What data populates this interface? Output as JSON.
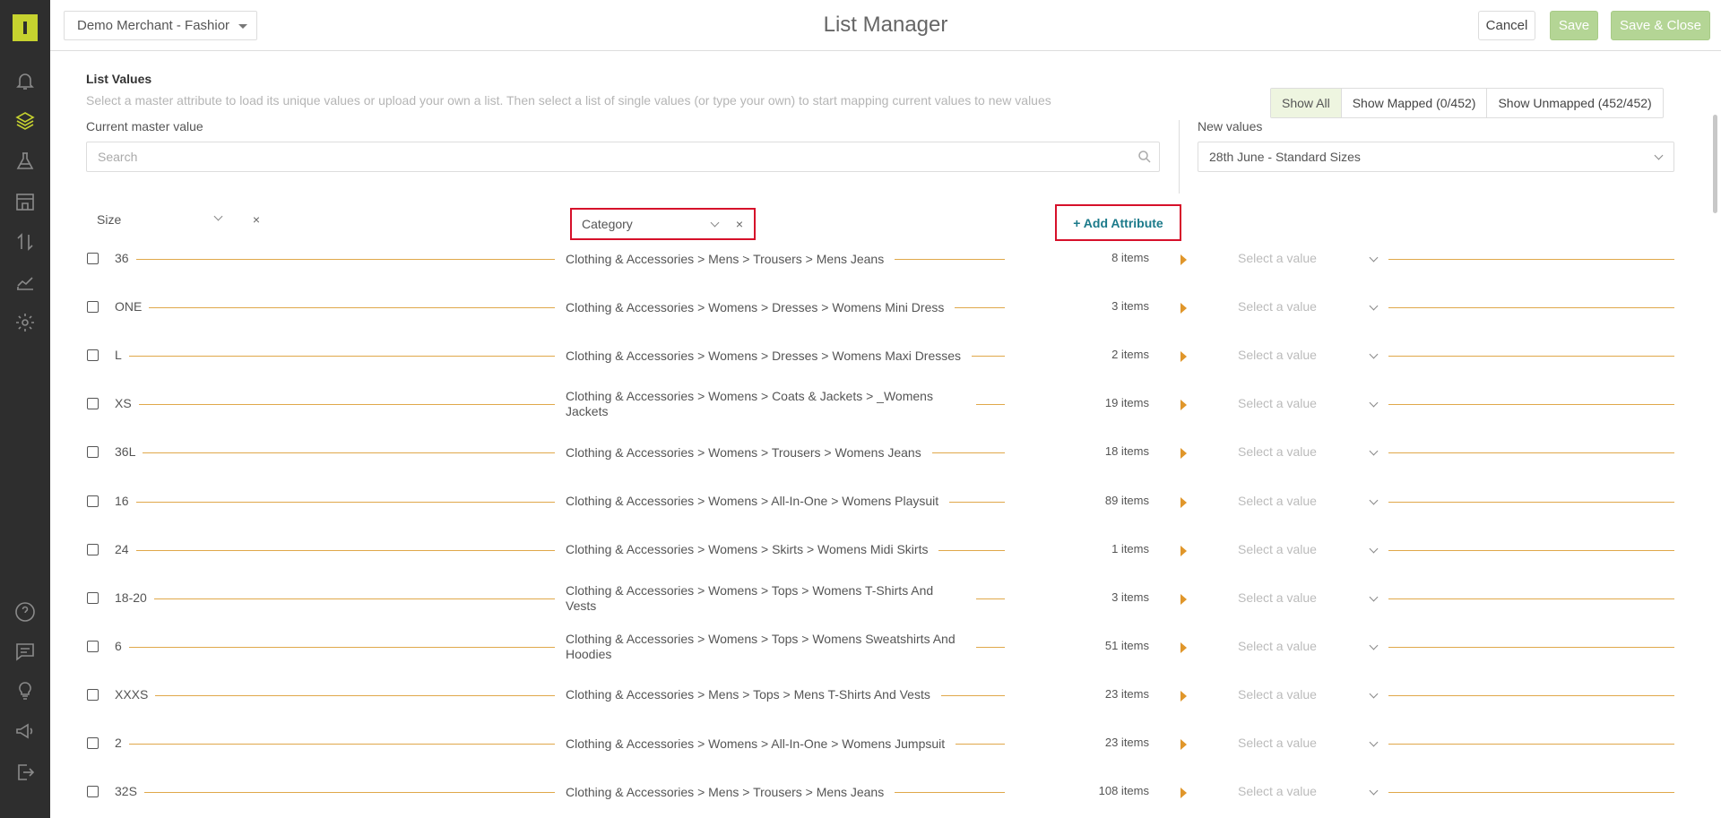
{
  "header": {
    "merchant": "Demo Merchant - Fashior",
    "title": "List Manager",
    "cancel_label": "Cancel",
    "save_label": "Save",
    "save_close_label": "Save & Close"
  },
  "sidebar": {
    "icons": [
      "bell-icon",
      "layers-icon",
      "flask-icon",
      "store-icon",
      "transfer-icon",
      "chart-icon",
      "gear-icon",
      "help-icon",
      "chat-icon",
      "lightbulb-icon",
      "megaphone-icon",
      "logout-icon"
    ],
    "active": "layers-icon"
  },
  "list_values": {
    "title": "List Values",
    "description": "Select a master attribute to load its unique values or upload your own a list. Then select a list of single values (or type your own) to start mapping current values to new values"
  },
  "filters": [
    {
      "label": "Show All",
      "active": true
    },
    {
      "label": "Show Mapped (0/452)",
      "active": false
    },
    {
      "label": "Show Unmapped (452/452)",
      "active": false
    }
  ],
  "current_master": {
    "label": "Current master value",
    "search_placeholder": "Search"
  },
  "new_values": {
    "label": "New values",
    "selected": "28th June - Standard Sizes"
  },
  "attributes": {
    "size": "Size",
    "category": "Category",
    "add_label": "+ Add Attribute"
  },
  "rows": [
    {
      "value": "36",
      "category": "Clothing & Accessories > Mens > Trousers > Mens Jeans",
      "count": "8 items",
      "placeholder": "Select a value"
    },
    {
      "value": "ONE",
      "category": "Clothing & Accessories > Womens > Dresses > Womens Mini Dress",
      "count": "3 items",
      "placeholder": "Select a value"
    },
    {
      "value": "L",
      "category": "Clothing & Accessories > Womens > Dresses > Womens Maxi Dresses",
      "count": "2 items",
      "placeholder": "Select a value"
    },
    {
      "value": "XS",
      "category": "Clothing & Accessories > Womens > Coats & Jackets > _Womens Jackets",
      "count": "19 items",
      "placeholder": "Select a value"
    },
    {
      "value": "36L",
      "category": "Clothing & Accessories > Womens > Trousers > Womens Jeans",
      "count": "18 items",
      "placeholder": "Select a value"
    },
    {
      "value": "16",
      "category": "Clothing & Accessories > Womens > All-In-One > Womens Playsuit",
      "count": "89 items",
      "placeholder": "Select a value"
    },
    {
      "value": "24",
      "category": "Clothing & Accessories > Womens > Skirts > Womens Midi Skirts",
      "count": "1 items",
      "placeholder": "Select a value"
    },
    {
      "value": "18-20",
      "category": "Clothing & Accessories > Womens > Tops > Womens T-Shirts And Vests",
      "count": "3 items",
      "placeholder": "Select a value"
    },
    {
      "value": "6",
      "category": "Clothing & Accessories > Womens > Tops > Womens Sweatshirts And Hoodies",
      "count": "51 items",
      "placeholder": "Select a value"
    },
    {
      "value": "XXXS",
      "category": "Clothing & Accessories > Mens > Tops > Mens T-Shirts And Vests",
      "count": "23 items",
      "placeholder": "Select a value"
    },
    {
      "value": "2",
      "category": "Clothing & Accessories > Womens > All-In-One > Womens Jumpsuit",
      "count": "23 items",
      "placeholder": "Select a value"
    },
    {
      "value": "32S",
      "category": "Clothing & Accessories > Mens > Trousers > Mens Jeans",
      "count": "108 items",
      "placeholder": "Select a value"
    }
  ],
  "colors": {
    "sidebar_bg": "#2e2e2e",
    "accent": "#c6d22f",
    "save_button": "#b4d595",
    "mapping_line": "#e0a84a",
    "highlight_border": "#d6102a",
    "add_attribute_text": "#1b7a8a"
  }
}
